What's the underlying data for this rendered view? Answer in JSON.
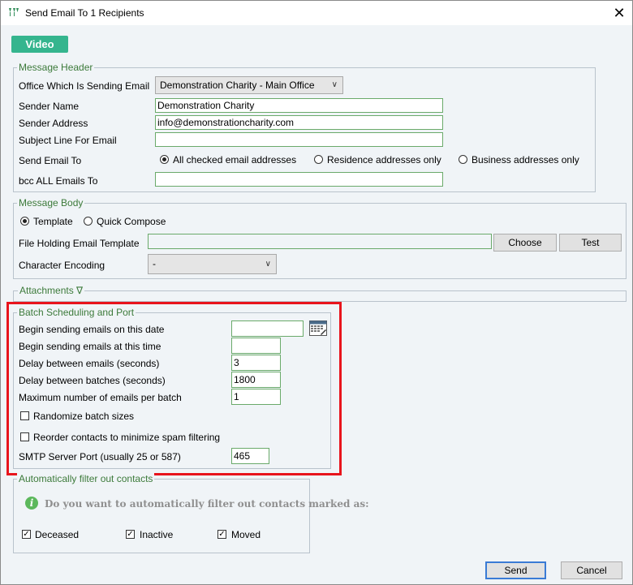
{
  "window": {
    "title": "Send Email To 1 Recipients",
    "close_glyph": "✕"
  },
  "video_button": "Video",
  "message_header": {
    "legend": "Message Header",
    "office_label": "Office Which Is Sending Email",
    "office_value": "Demonstration Charity - Main Office",
    "sender_name_label": "Sender Name",
    "sender_name_value": "Demonstration Charity",
    "sender_address_label": "Sender Address",
    "sender_address_value": "info@demonstrationcharity.com",
    "subject_label": "Subject Line For Email",
    "subject_value": "",
    "send_to_label": "Send Email To",
    "send_to_options": [
      "All checked email addresses",
      "Residence addresses only",
      "Business addresses only"
    ],
    "send_to_selected": 0,
    "bcc_label": "bcc ALL Emails To",
    "bcc_value": ""
  },
  "message_body": {
    "legend": "Message Body",
    "mode_options": [
      "Template",
      "Quick Compose"
    ],
    "mode_selected": 0,
    "template_file_label": "File Holding Email Template",
    "template_file_value": "",
    "choose_button": "Choose",
    "test_button": "Test",
    "encoding_label": "Character Encoding",
    "encoding_value": "-"
  },
  "attachments": {
    "label": "Attachments ∇"
  },
  "batch": {
    "legend": "Batch Scheduling and Port",
    "begin_date_label": "Begin sending emails on this date",
    "begin_date_value": "",
    "begin_time_label": "Begin sending emails at this time",
    "begin_time_value": "",
    "delay_emails_label": "Delay between emails (seconds)",
    "delay_emails_value": "3",
    "delay_batches_label": "Delay between batches (seconds)",
    "delay_batches_value": "1800",
    "max_per_batch_label": "Maximum number of emails per batch",
    "max_per_batch_value": "1",
    "randomize_label": "Randomize batch sizes",
    "randomize_checked": false,
    "reorder_label": "Reorder contacts to minimize spam filtering",
    "reorder_checked": false,
    "smtp_port_label": "SMTP Server Port (usually 25 or 587)",
    "smtp_port_value": "465"
  },
  "auto_filter": {
    "legend": "Automatically filter out contacts",
    "question": "Do you want to automatically filter out contacts marked as:",
    "options": [
      {
        "label": "Deceased",
        "checked": true
      },
      {
        "label": "Inactive",
        "checked": true
      },
      {
        "label": "Moved",
        "checked": true
      }
    ]
  },
  "footer": {
    "send_button": "Send",
    "cancel_button": "Cancel"
  },
  "colors": {
    "accent_green": "#35b58e",
    "highlight_red": "#e8141c",
    "legend_green": "#3c7a3a"
  }
}
